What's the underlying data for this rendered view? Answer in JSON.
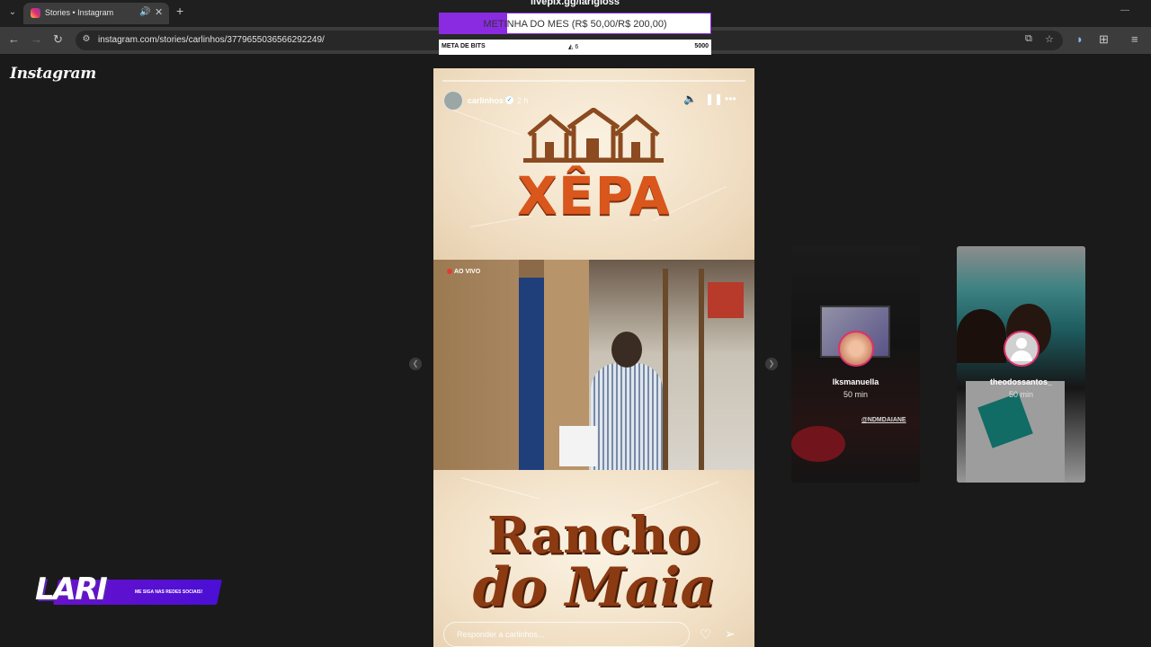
{
  "browser": {
    "tab_title": "Stories • Instagram",
    "url": "instagram.com/stories/carlinhos/3779655036566292249/",
    "tab_list_glyph": "⌄",
    "new_tab_glyph": "+",
    "close_glyph": "✕",
    "audio_glyph": "🔊",
    "back_glyph": "←",
    "forward_glyph": "→",
    "reload_glyph": "↻",
    "minimize_glyph": "—"
  },
  "instagram": {
    "logo": "Instagram",
    "story": {
      "username": "carlinhos",
      "time": "2 h",
      "live_label": "AO VIVO",
      "reply_placeholder": "Responder a carlinhos...",
      "title_top": "XÊPA",
      "title_bottom_1": "Rancho",
      "title_bottom_2": "do Maia"
    },
    "previews": [
      {
        "username": "lksmanuella",
        "time": "50 min",
        "overlay_text": "@NDMDAIANE"
      },
      {
        "username": "theodossantos_",
        "time": "50 min"
      }
    ]
  },
  "stream_overlay": {
    "top_url": "livepix.gg/larigloss",
    "goal_label": "METINHA DO MES (R$ 50,00/R$ 200,00)",
    "goal_progress": 0.25,
    "bits_label": "META DE BITS",
    "bits_count": "6",
    "bits_goal": "5000",
    "brand": "LARI",
    "brand_sub": "ME SIGA NAS REDES SOCIAIS!"
  },
  "colors": {
    "accent_purple": "#8a2be2",
    "story_orange": "#d9561c",
    "story_brown": "#8b3a12"
  }
}
